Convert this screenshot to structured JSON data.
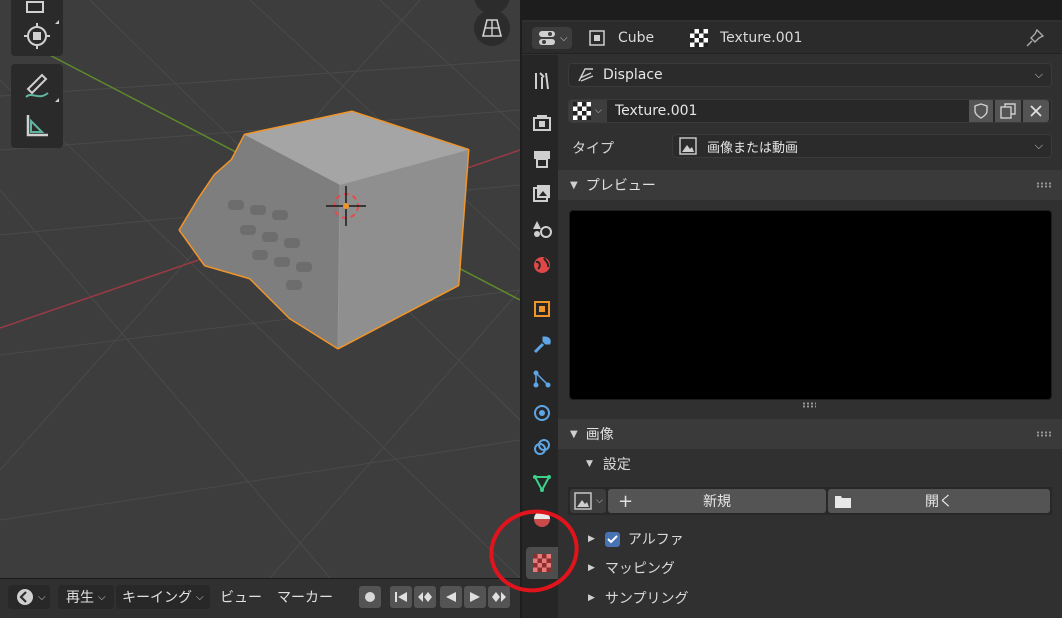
{
  "viewport": {
    "tools": [
      "select-box-icon",
      "cursor-icon",
      "annotate-icon",
      "measure-icon"
    ],
    "gizmo_icon": "grid-perspective-icon",
    "object": "Cube (displaced)"
  },
  "timeline": {
    "playback_label": "再生",
    "keying_label": "キーイング",
    "view_label": "ビュー",
    "marker_label": "マーカー"
  },
  "properties": {
    "breadcrumb": {
      "object_name": "Cube",
      "texture_name": "Texture.001"
    },
    "modifier": {
      "name": "Displace"
    },
    "texture_field": {
      "name": "Texture.001"
    },
    "type": {
      "label": "タイプ",
      "value": "画像または動画"
    },
    "preview": {
      "title": "プレビュー"
    },
    "image": {
      "title": "画像",
      "settings_label": "設定",
      "new_label": "新規",
      "open_label": "開く"
    },
    "subpanels": [
      {
        "label": "アルファ",
        "checked": true
      },
      {
        "label": "マッピング"
      },
      {
        "label": "サンプリング"
      }
    ],
    "tabs": [
      "tool-icon",
      "render-icon",
      "output-icon",
      "view-layer-icon",
      "scene-icon",
      "world-icon",
      "object-icon",
      "modifier-icon",
      "particles-icon",
      "physics-icon",
      "constraints-icon",
      "data-icon",
      "material-icon",
      "texture-icon"
    ],
    "colors": {
      "accent": "#4772b3",
      "selection": "#f0952a",
      "highlight_circle": "#e0141c"
    }
  }
}
